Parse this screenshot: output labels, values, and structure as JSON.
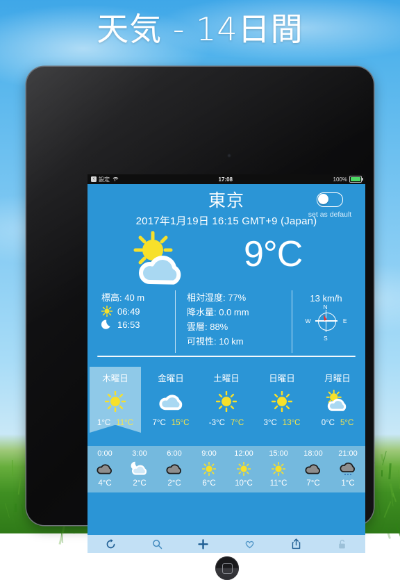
{
  "page": {
    "title": "天気 - 14日間"
  },
  "status_bar": {
    "back_glyph": "‹",
    "back_app": "設定",
    "wifi_icon": "wifi-icon",
    "time": "17:08",
    "battery_percent": "100%",
    "battery_icon": "battery-full-icon"
  },
  "header": {
    "city": "東京",
    "datetime": "2017年1月19日  16:15  GMT+9 (Japan)",
    "toggle": {
      "name": "set-as-default-toggle",
      "state": "off"
    },
    "toggle_label": "set as default"
  },
  "current": {
    "icon": "sun-behind-cloud-icon",
    "temperature": "9°C"
  },
  "details": {
    "altitude": "標高: 40 m",
    "sunrise": "06:49",
    "sunset": "16:53",
    "sunrise_icon": "sun-icon",
    "sunset_icon": "moon-icon",
    "humidity": "相対湿度: 77%",
    "precipitation": "降水量: 0.0 mm",
    "clouds": "雲層: 88%",
    "visibility": "可視性: 10 km",
    "wind_speed": "13 km/h",
    "compass": {
      "n": "N",
      "e": "E",
      "s": "S",
      "w": "W",
      "needle_deg": -20
    }
  },
  "daily_forecast": [
    {
      "day": "木曜日",
      "icon": "sun-icon",
      "min": "1°C",
      "max": "11°C",
      "selected": true
    },
    {
      "day": "金曜日",
      "icon": "cloud-icon",
      "min": "7°C",
      "max": "15°C",
      "selected": false
    },
    {
      "day": "土曜日",
      "icon": "sun-icon",
      "min": "-3°C",
      "max": "7°C",
      "selected": false
    },
    {
      "day": "日曜日",
      "icon": "sun-icon",
      "min": "3°C",
      "max": "13°C",
      "selected": false
    },
    {
      "day": "月曜日",
      "icon": "sun-behind-cloud-icon",
      "min": "0°C",
      "max": "5°C",
      "selected": false
    }
  ],
  "hourly_forecast": [
    {
      "time": "0:00",
      "icon": "overcast-cloud-icon",
      "temp": "4°C"
    },
    {
      "time": "3:00",
      "icon": "moon-behind-cloud-icon",
      "temp": "2°C"
    },
    {
      "time": "6:00",
      "icon": "overcast-cloud-icon",
      "temp": "2°C"
    },
    {
      "time": "9:00",
      "icon": "sun-icon",
      "temp": "6°C"
    },
    {
      "time": "12:00",
      "icon": "sun-icon",
      "temp": "10°C"
    },
    {
      "time": "15:00",
      "icon": "sun-icon",
      "temp": "11°C"
    },
    {
      "time": "18:00",
      "icon": "overcast-cloud-icon",
      "temp": "7°C"
    },
    {
      "time": "21:00",
      "icon": "snow-cloud-icon",
      "temp": "1°C"
    }
  ],
  "toolbar": [
    {
      "name": "refresh-button",
      "icon": "refresh-icon"
    },
    {
      "name": "search-button",
      "icon": "search-icon"
    },
    {
      "name": "add-button",
      "icon": "plus-icon"
    },
    {
      "name": "favorite-button",
      "icon": "heart-icon"
    },
    {
      "name": "share-button",
      "icon": "share-icon"
    },
    {
      "name": "lock-button",
      "icon": "lock-icon"
    }
  ],
  "colors": {
    "app_blue": "#2b95d6",
    "hourly_blue": "#74b9de",
    "selected_day": "#8fc9e8",
    "toolbar": "#c2e0f5",
    "sun_yellow": "#f7e02a",
    "max_temp": "#f7e64a"
  }
}
